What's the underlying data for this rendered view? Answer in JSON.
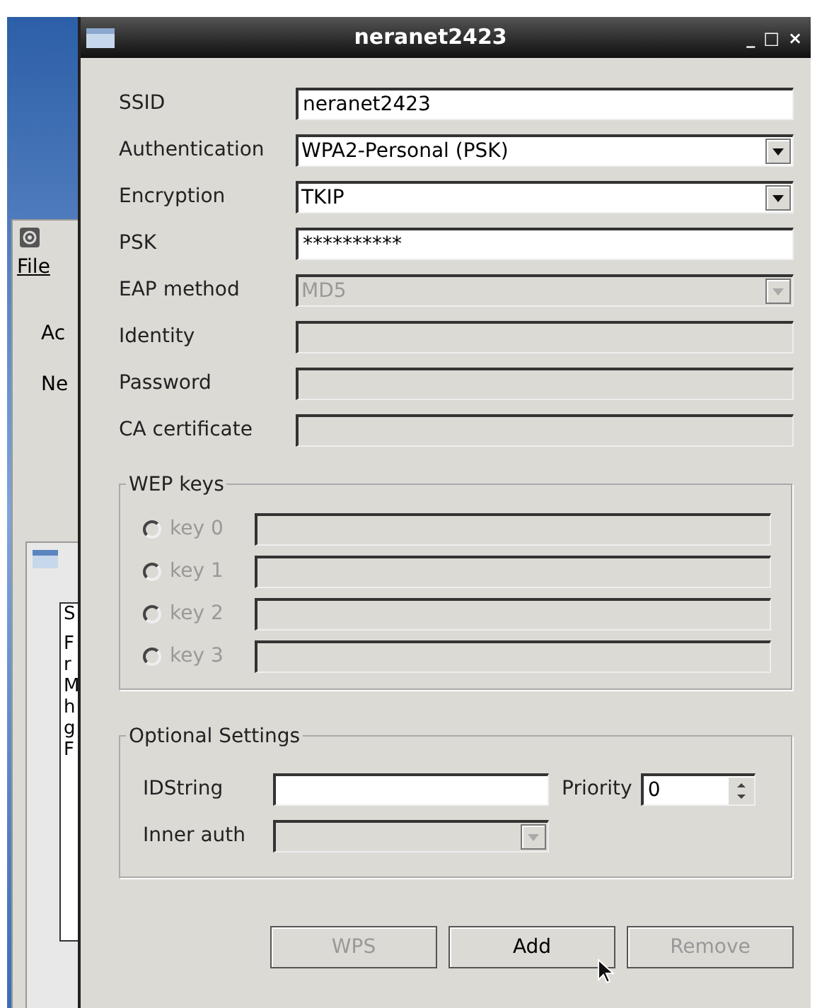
{
  "background_window": {
    "menu": "File",
    "lines": [
      "Ac",
      "Ne"
    ]
  },
  "background_list": {
    "items": [
      "S",
      "F",
      "r",
      "M",
      "h",
      "g",
      "F"
    ]
  },
  "window": {
    "title": "neranet2423",
    "controls": [
      "_",
      "□",
      "×"
    ]
  },
  "fields": [
    {
      "kind": "text",
      "label": "SSID",
      "value": "neranet2423",
      "disabled": false
    },
    {
      "kind": "combo",
      "label": "Authentication",
      "value": "WPA2-Personal (PSK)",
      "disabled": false
    },
    {
      "kind": "combo",
      "label": "Encryption",
      "value": "TKIP",
      "disabled": false
    },
    {
      "kind": "text",
      "label": "PSK",
      "value": "**********",
      "disabled": false
    },
    {
      "kind": "combo",
      "label": "EAP method",
      "value": "MD5",
      "disabled": true
    },
    {
      "kind": "text",
      "label": "Identity",
      "disabled": true
    },
    {
      "kind": "text",
      "label": "Password",
      "disabled": true
    },
    {
      "kind": "text",
      "label": "CA certificate",
      "disabled": true
    }
  ],
  "wep_keys": {
    "title": "WEP keys",
    "keys": [
      {
        "label": "key 0",
        "selected": false,
        "disabled": true
      },
      {
        "label": "key 1",
        "selected": false,
        "disabled": true
      },
      {
        "label": "key 2",
        "selected": false,
        "disabled": true
      },
      {
        "label": "key 3",
        "selected": false,
        "disabled": true
      }
    ]
  },
  "optional_settings": {
    "title": "Optional Settings",
    "idstring_label": "IDString",
    "priority_label": "Priority",
    "priority": "0",
    "inner_auth_label": "Inner auth",
    "inner_auth_disabled": true
  },
  "buttons": [
    {
      "label": "WPS",
      "disabled": true
    },
    {
      "label": "Add",
      "disabled": false
    },
    {
      "label": "Remove",
      "disabled": true
    }
  ]
}
